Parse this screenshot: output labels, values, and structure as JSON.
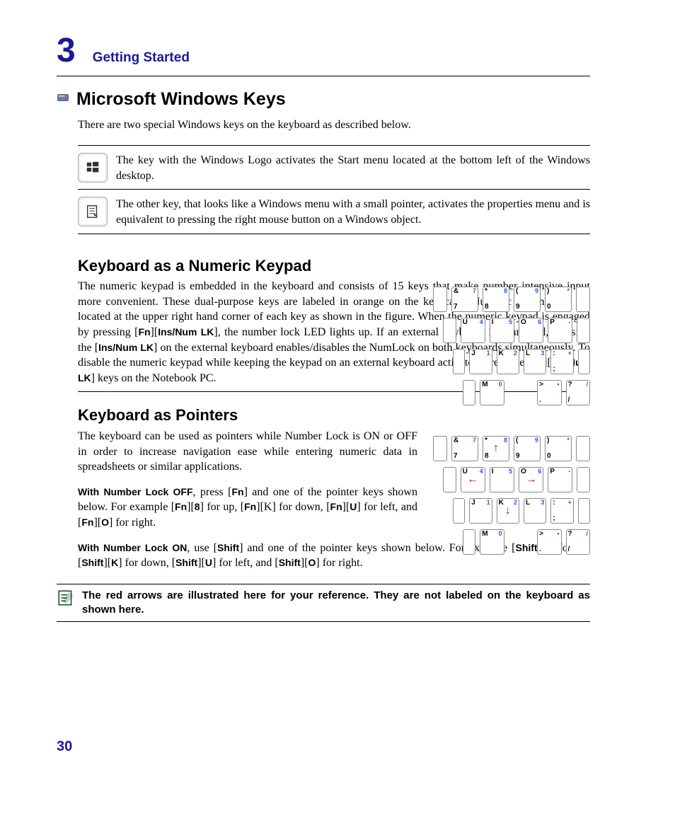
{
  "chapter": {
    "number": "3",
    "name": "Getting Started"
  },
  "pageNumber": "30",
  "section1": {
    "title": "Microsoft Windows Keys",
    "intro": "There are two special Windows keys on the keyboard as described below.",
    "winKey": "The key with the Windows Logo activates the Start menu located at the bottom left of the Windows desktop.",
    "menuKey": "The other key, that looks like a Windows menu with a small pointer, activates the properties menu and is equivalent to pressing the right mouse button on a Windows object."
  },
  "section2": {
    "title": "Keyboard as a Numeric Keypad",
    "p1a": "The numeric keypad is embedded in the keyboard and consists of 15 keys that make number intensive input more convenient. These dual-purpose keys are labeled in orange on the key caps. Numeric assignments are located at the upper right hand corner of each key as shown in the figure. When the numeric keypad is engaged by pressing [",
    "fn": "Fn",
    "p1b": "][",
    "ins": "Ins/Num LK",
    "p1c": "], the number lock LED lights up. If an external keyboard is connected, pressing the [",
    "p1d": "] on the external keyboard enables/disables the NumLock on both keyboards simultaneously. To disable the numeric keypad while keeping the keypad on an external keyboard activated, press the  [",
    "p1e": "][",
    "p1f": "] keys on the Notebook PC."
  },
  "section3": {
    "title": "Keyboard as Pointers",
    "p1": "The keyboard can be used as pointers while Number Lock is ON or OFF in order to increase navigation ease while entering numeric data in spreadsheets or similar applications.",
    "p2a": "With Number Lock OFF",
    "p2b": ", press [",
    "fn": "Fn",
    "p2c": "] and one of the pointer keys shown below. For example [",
    "eight": "8",
    "p2d": "] for up, [",
    "p2e": "][K] for down, [",
    "u": "U",
    "p2f": "] for left, and [",
    "o": "O",
    "p2g": "] for right.",
    "p3a": "With Number Lock ON",
    "p3b": ", use [",
    "shift": "Shift",
    "p3c": "] and one of the pointer keys shown below. For example [",
    "p3d": "] for up, [",
    "k": "K",
    "p3e": "] for down, [",
    "p3f": "] for left, and [",
    "p3g": "] for right."
  },
  "note": "The red arrows are illustrated here for your reference. They are not labeled on the keyboard as shown here.",
  "keypad": {
    "r1": [
      {
        "tl": "&",
        "tr": "7",
        "bl": "7"
      },
      {
        "tl": "*",
        "tr": "8",
        "bl": "8"
      },
      {
        "tl": "(",
        "tr": "9",
        "bl": "9"
      },
      {
        "tl": ")",
        "tr": "*",
        "bl": "0"
      }
    ],
    "r2": [
      {
        "tl": "U",
        "tr": "4"
      },
      {
        "tl": "I",
        "tr": "5"
      },
      {
        "tl": "O",
        "tr": "6"
      },
      {
        "tl": "P",
        "tr": "-"
      }
    ],
    "r3": [
      {
        "tl": "J",
        "tr": "1"
      },
      {
        "tl": "K",
        "tr": "2"
      },
      {
        "tl": "L",
        "tr": "3"
      },
      {
        "tl": ":",
        "tr": "+",
        "bl": ";"
      }
    ],
    "r4": [
      {
        "tl": "M",
        "tr": "0"
      },
      {
        "tl": ">",
        "tr": "•",
        "bl": "."
      },
      {
        "tl": "?",
        "tr": "/",
        "bl": "/"
      }
    ]
  }
}
